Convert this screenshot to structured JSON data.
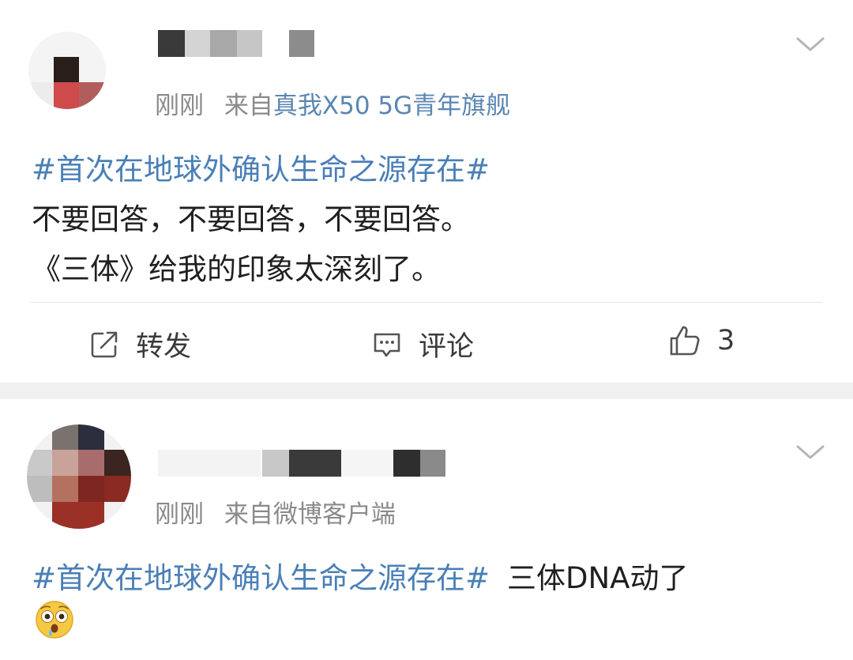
{
  "posts": [
    {
      "meta_time": "刚刚",
      "meta_from": "来自",
      "meta_source": "真我X50 5G青年旗舰",
      "topic": "#首次在地球外确认生命之源存在#",
      "text_lines": [
        "不要回答，不要回答，不要回答。",
        "《三体》给我的印象太深刻了。"
      ],
      "actions": {
        "repost_label": "转发",
        "comment_label": "评论",
        "like_count": "3"
      },
      "icons": [
        "avatar",
        "chevron-down-icon",
        "repost-icon",
        "comment-icon",
        "like-icon"
      ]
    },
    {
      "meta_time": "刚刚",
      "meta_from": "来自",
      "meta_source": "微博客户端",
      "topic": "#首次在地球外确认生命之源存在#",
      "text_after_topic": "三体DNA动了",
      "emoji": "flushed-face-emoji",
      "icons": [
        "avatar",
        "chevron-down-icon"
      ]
    }
  ],
  "colors": {
    "topic": "#4a7fb6",
    "meta": "#8a8a8a",
    "separator": "#f0f0f0"
  }
}
